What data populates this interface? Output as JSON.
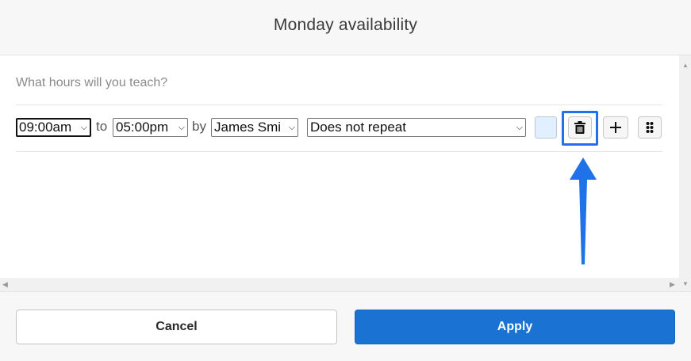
{
  "dialog": {
    "title": "Monday availability"
  },
  "content": {
    "question": "What hours will you teach?",
    "row": {
      "start_time": "09:00am",
      "to_label": "to",
      "end_time": "05:00pm",
      "by_label": "by",
      "teacher": "James Smi",
      "repeat": "Does not repeat"
    }
  },
  "footer": {
    "cancel_label": "Cancel",
    "apply_label": "Apply"
  },
  "icons": {
    "delete": "trash-icon",
    "add": "plus-icon",
    "drag": "drag-handle-icon",
    "annotation": "arrow-up-icon"
  },
  "colors": {
    "accent": "#1a73d3",
    "highlight": "#1f72e8",
    "color_swatch": "#e1efff"
  }
}
